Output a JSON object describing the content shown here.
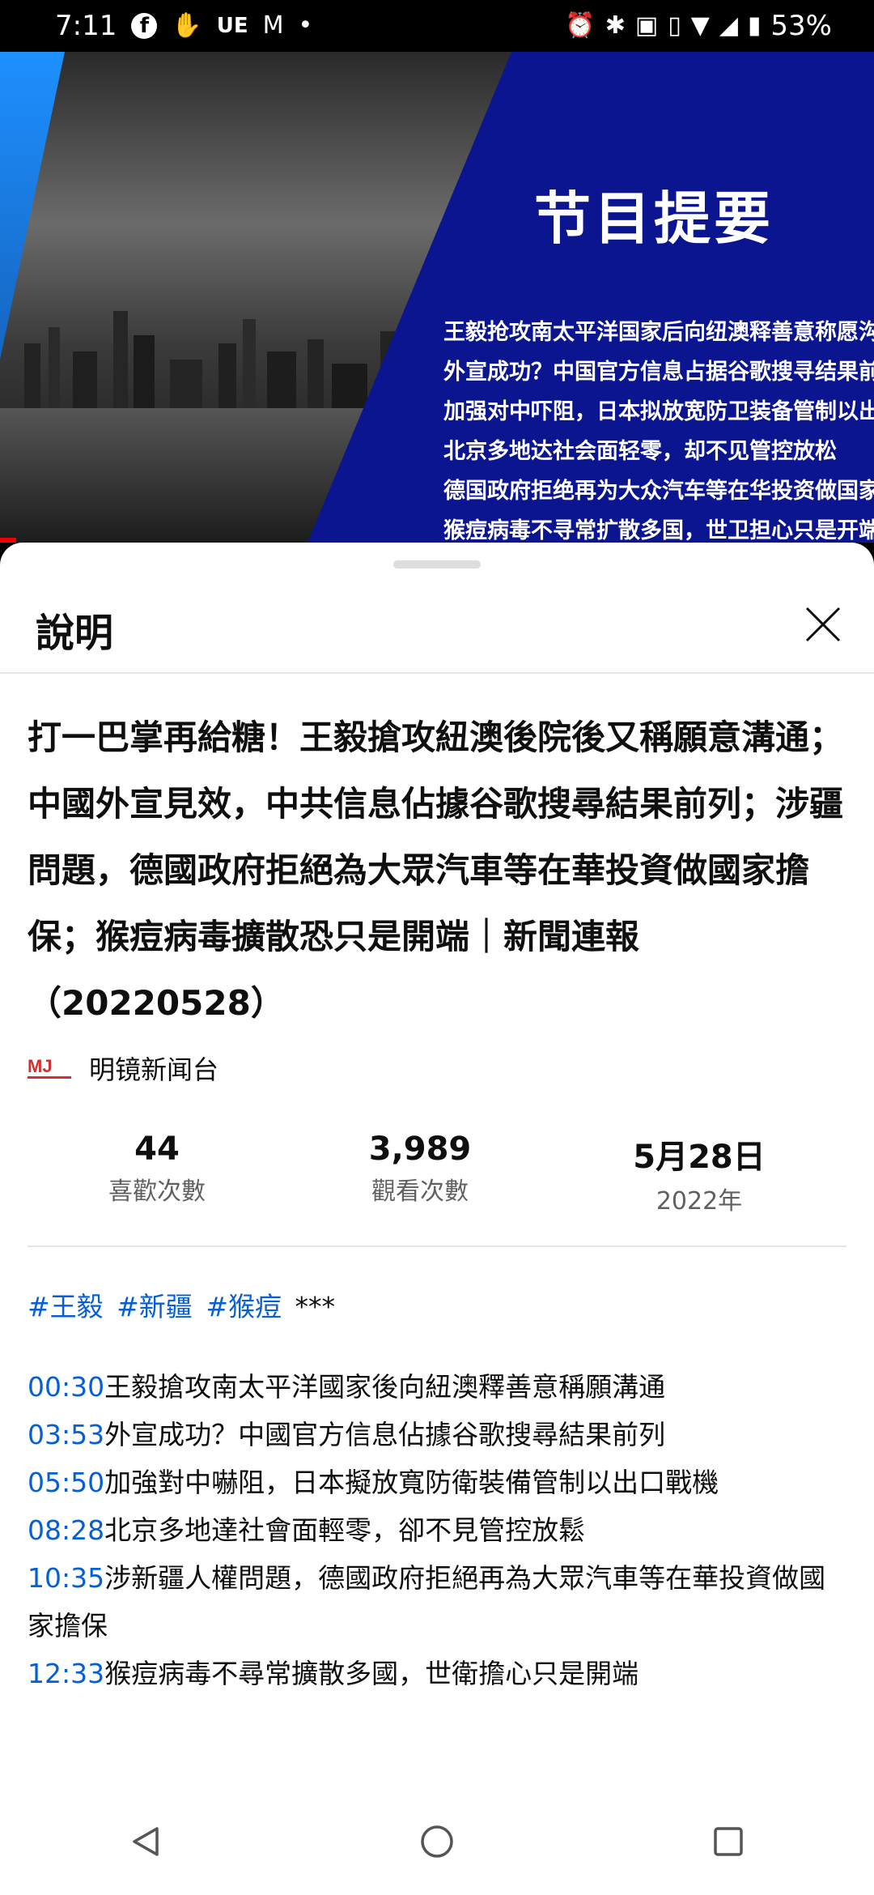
{
  "status_bar": {
    "time": "7:11",
    "left_icons": [
      "facebook-icon",
      "hand-icon",
      "ue-text",
      "gmail-icon",
      "dot"
    ],
    "ue_label": "UE",
    "battery": "53%"
  },
  "video": {
    "panel_title": "节目提要",
    "panel_lines": [
      "王毅抢攻南太平洋国家后向纽澳释善意称愿沟通",
      "外宣成功？中国官方信息占据谷歌搜寻结果前列",
      "加强对中吓阻，日本拟放宽防卫装备管制以出口战机",
      "北京多地达社会面轻零，却不见管控放松",
      "德国政府拒绝再为大众汽车等在华投资做国家担保",
      "猴痘病毒不寻常扩散多国，世卫担心只是开端"
    ]
  },
  "sheet": {
    "title": "說明",
    "headline": "打一巴掌再給糖！王毅搶攻紐澳後院後又稱願意溝通；中國外宣見效，中共信息佔據谷歌搜尋結果前列；涉疆問題，德國政府拒絕為大眾汽車等在華投資做國家擔保；猴痘病毒擴散恐只是開端｜新聞連報（20220528）",
    "channel_name": "明镜新闻台",
    "stats": {
      "likes_value": "44",
      "likes_label": "喜歡次數",
      "views_value": "3,989",
      "views_label": "觀看次數",
      "date_value": "5月28日",
      "date_year": "2022年"
    },
    "hashtags": [
      "#王毅",
      "#新疆",
      "#猴痘"
    ],
    "hashtag_suffix": "***",
    "chapters": [
      {
        "time": "00:30",
        "text": "王毅搶攻南太平洋國家後向紐澳釋善意稱願溝通"
      },
      {
        "time": "03:53",
        "text": "外宣成功？中國官方信息佔據谷歌搜尋結果前列"
      },
      {
        "time": "05:50",
        "text": "加強對中嚇阻，日本擬放寬防衛裝備管制以出口戰機"
      },
      {
        "time": "08:28",
        "text": "北京多地達社會面輕零，卻不見管控放鬆"
      },
      {
        "time": "10:35",
        "text": "涉新疆人權問題，德國政府拒絕再為大眾汽車等在華投資做國家擔保"
      },
      {
        "time": "12:33",
        "text": "猴痘病毒不尋常擴散多國，世衛擔心只是開端"
      }
    ]
  },
  "colors": {
    "link_blue": "#065fd4",
    "video_blue": "#0b1590",
    "progress_red": "#e00000"
  },
  "nav": [
    "back-icon",
    "home-icon",
    "recents-icon"
  ]
}
